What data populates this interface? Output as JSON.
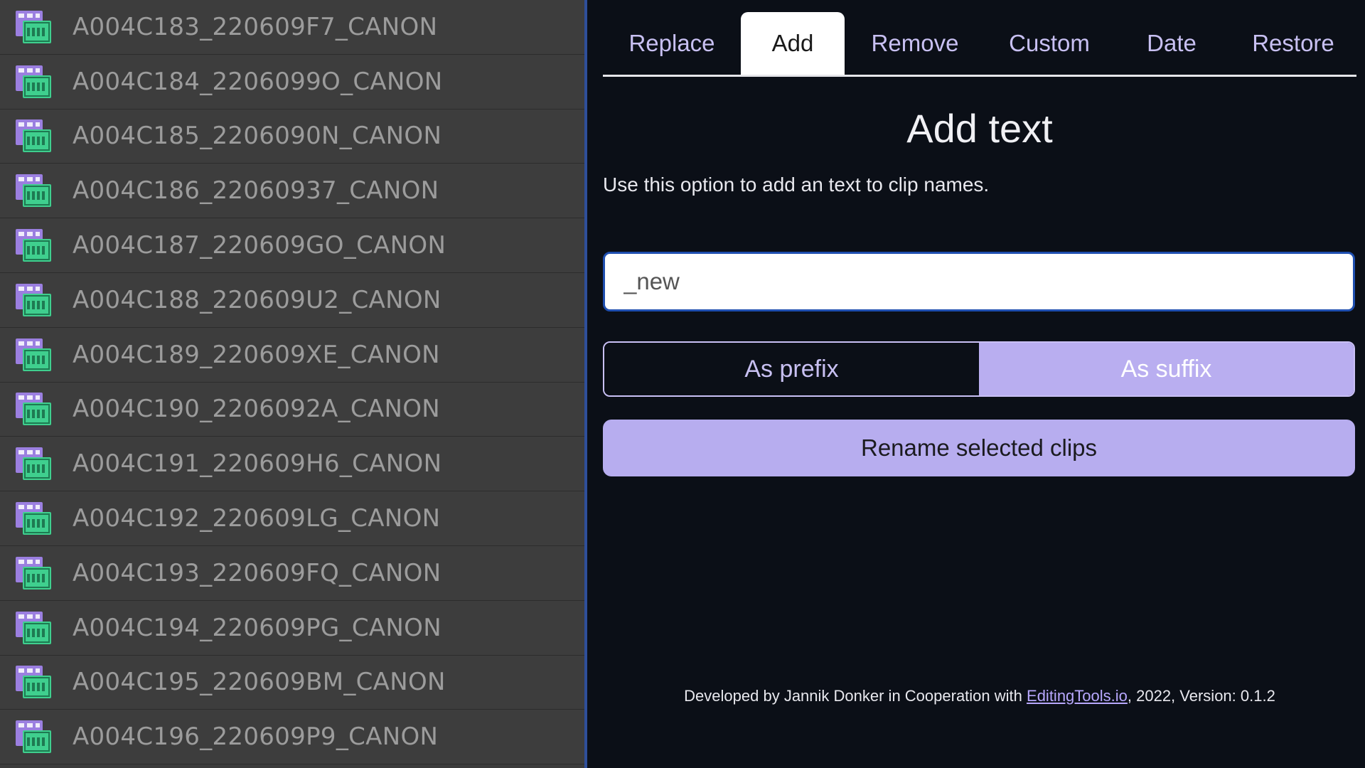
{
  "clips": [
    "A004C183_220609F7_CANON",
    "A004C184_2206099O_CANON",
    "A004C185_2206090N_CANON",
    "A004C186_22060937_CANON",
    "A004C187_220609GO_CANON",
    "A004C188_220609U2_CANON",
    "A004C189_220609XE_CANON",
    "A004C190_2206092A_CANON",
    "A004C191_220609H6_CANON",
    "A004C192_220609LG_CANON",
    "A004C193_220609FQ_CANON",
    "A004C194_220609PG_CANON",
    "A004C195_220609BM_CANON",
    "A004C196_220609P9_CANON"
  ],
  "clip_icon": "film-clip-icon",
  "tabs": [
    {
      "label": "Replace"
    },
    {
      "label": "Add"
    },
    {
      "label": "Remove"
    },
    {
      "label": "Custom"
    },
    {
      "label": "Date"
    },
    {
      "label": "Restore"
    }
  ],
  "active_tab": "Add",
  "heading": "Add text",
  "description": "Use this option to add an text to clip names.",
  "input": {
    "value": "_new",
    "placeholder": ""
  },
  "position_toggle": {
    "prefix_label": "As prefix",
    "suffix_label": "As suffix",
    "selected": "As suffix"
  },
  "rename_button": "Rename selected clips",
  "footer": {
    "before": "Developed by Jannik Donker in Cooperation with ",
    "link": "EditingTools.io",
    "after": ", 2022, Version: 0.1.2"
  },
  "colors": {
    "accent": "#b7adef",
    "tab_text": "#c8c0f2",
    "panel_bg": "#0b0f17",
    "list_bg": "#3d3d3d",
    "icon_purple": "#9b7fe0",
    "icon_green": "#3fcf8e"
  }
}
